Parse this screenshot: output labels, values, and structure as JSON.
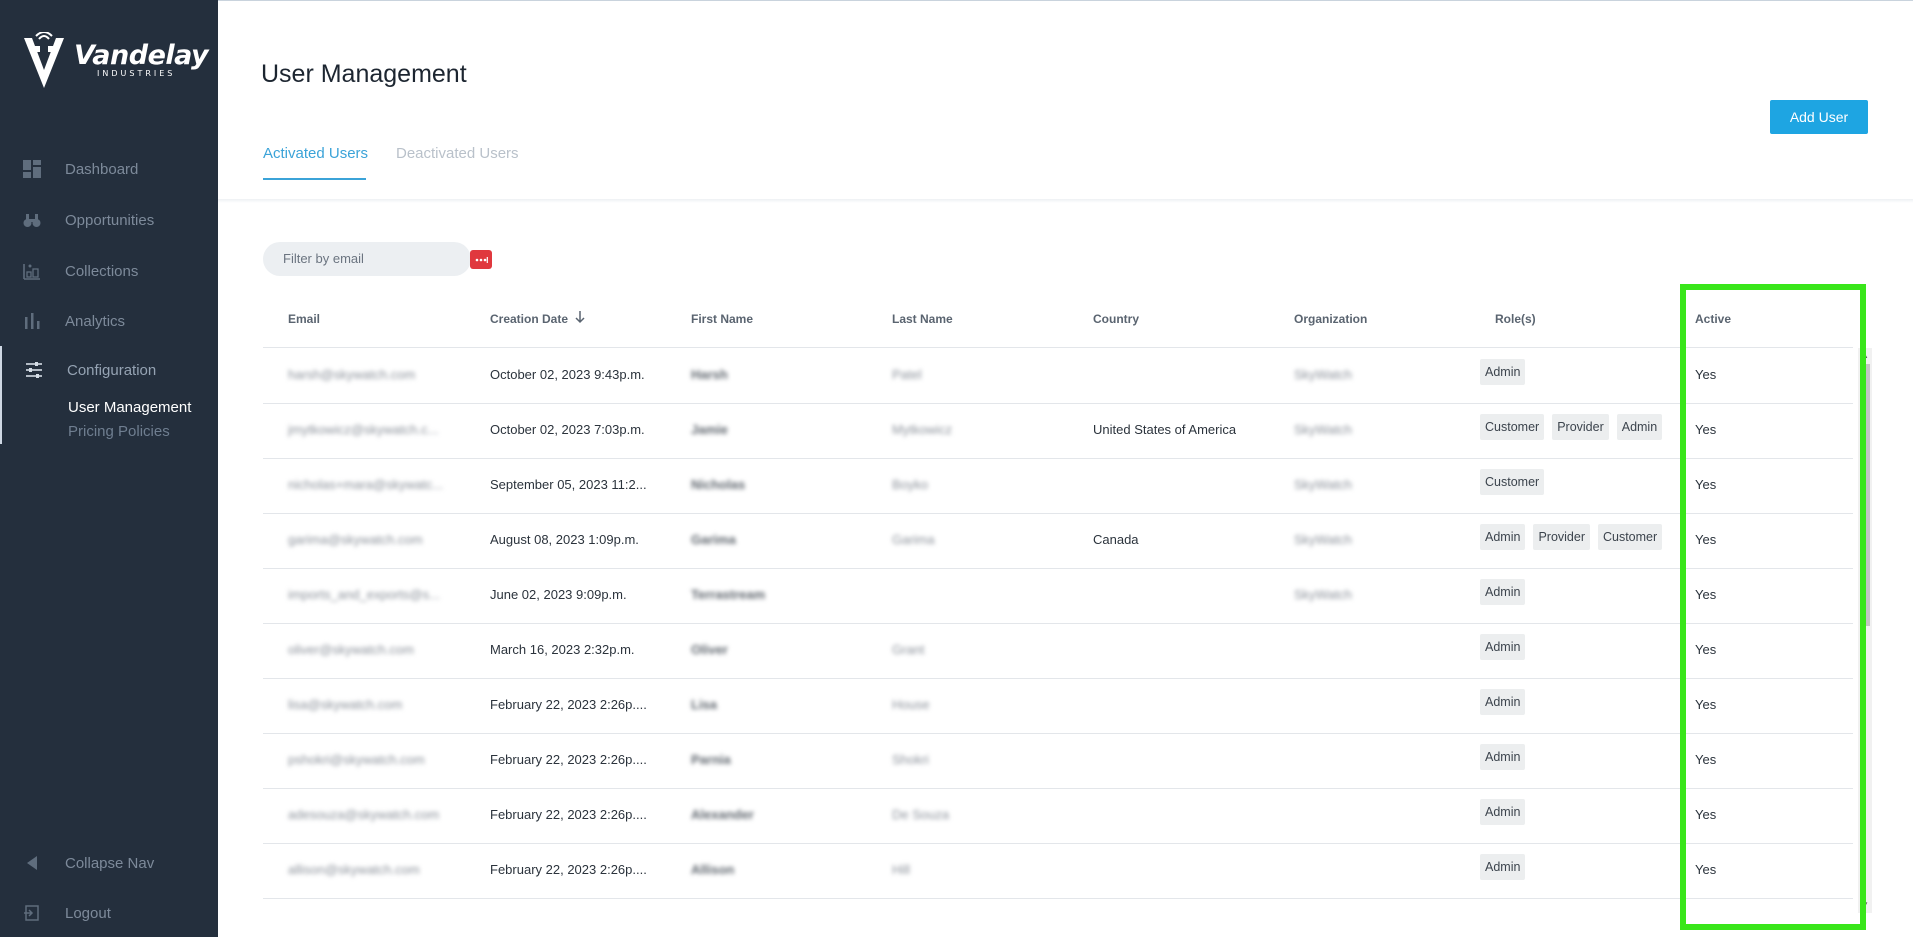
{
  "brand": {
    "name": "Vandelay",
    "sub": "INDUSTRIES"
  },
  "sidebar": {
    "items": [
      {
        "label": "Dashboard",
        "icon": "dashboard-icon"
      },
      {
        "label": "Opportunities",
        "icon": "binoculars-icon"
      },
      {
        "label": "Collections",
        "icon": "collections-icon"
      },
      {
        "label": "Analytics",
        "icon": "bar-chart-icon"
      },
      {
        "label": "Configuration",
        "icon": "sliders-icon"
      }
    ],
    "subitems": [
      {
        "label": "User Management",
        "active": true
      },
      {
        "label": "Pricing Policies",
        "active": false
      }
    ],
    "collapse": "Collapse Nav",
    "logout": "Logout"
  },
  "page": {
    "title": "User Management",
    "tabs": [
      {
        "label": "Activated Users",
        "active": true
      },
      {
        "label": "Deactivated Users",
        "active": false
      }
    ],
    "add_user": "Add User",
    "filter_placeholder": "Filter by email"
  },
  "table": {
    "headers": [
      "Email",
      "Creation Date",
      "First Name",
      "Last Name",
      "Country",
      "Organization",
      "Role(s)",
      "Active"
    ],
    "rows": [
      {
        "email": "harsh@skywatch.com",
        "date": "October 02, 2023 9:43p.m.",
        "first": "Harsh",
        "last": "Patel",
        "country": "",
        "org": "SkyWatch",
        "roles": [
          "Admin"
        ],
        "active": "Yes"
      },
      {
        "email": "jmytkowicz@skywatch.c...",
        "date": "October 02, 2023 7:03p.m.",
        "first": "Jamie",
        "last": "Mytkowicz",
        "country": "United States of America",
        "org": "SkyWatch",
        "roles": [
          "Customer",
          "Provider",
          "Admin"
        ],
        "active": "Yes"
      },
      {
        "email": "nicholas+mara@skywatc...",
        "date": "September 05, 2023 11:2...",
        "first": "Nicholas",
        "last": "Boyko",
        "country": "",
        "org": "SkyWatch",
        "roles": [
          "Customer"
        ],
        "active": "Yes"
      },
      {
        "email": "garima@skywatch.com",
        "date": "August 08, 2023 1:09p.m.",
        "first": "Garima",
        "last": "Garima",
        "country": "Canada",
        "org": "SkyWatch",
        "roles": [
          "Admin",
          "Provider",
          "Customer"
        ],
        "active": "Yes"
      },
      {
        "email": "imports_and_exports@s...",
        "date": "June 02, 2023 9:09p.m.",
        "first": "Terrastream",
        "last": "",
        "country": "",
        "org": "SkyWatch",
        "roles": [
          "Admin"
        ],
        "active": "Yes"
      },
      {
        "email": "oliver@skywatch.com",
        "date": "March 16, 2023 2:32p.m.",
        "first": "Oliver",
        "last": "Grant",
        "country": "",
        "org": "",
        "roles": [
          "Admin"
        ],
        "active": "Yes"
      },
      {
        "email": "lisa@skywatch.com",
        "date": "February 22, 2023 2:26p....",
        "first": "Lisa",
        "last": "House",
        "country": "",
        "org": "",
        "roles": [
          "Admin"
        ],
        "active": "Yes"
      },
      {
        "email": "pshokri@skywatch.com",
        "date": "February 22, 2023 2:26p....",
        "first": "Parnia",
        "last": "Shokri",
        "country": "",
        "org": "",
        "roles": [
          "Admin"
        ],
        "active": "Yes"
      },
      {
        "email": "adesouza@skywatch.com",
        "date": "February 22, 2023 2:26p....",
        "first": "Alexander",
        "last": "De Souza",
        "country": "",
        "org": "",
        "roles": [
          "Admin"
        ],
        "active": "Yes"
      },
      {
        "email": "allison@skywatch.com",
        "date": "February 22, 2023 2:26p....",
        "first": "Allison",
        "last": "Hill",
        "country": "",
        "org": "",
        "roles": [
          "Admin"
        ],
        "active": "Yes"
      }
    ]
  },
  "colors": {
    "sidebar": "#242f3d",
    "accent": "#3ba3d8",
    "button": "#1ea5e2",
    "highlight": "#39e61a",
    "filter_icon": "#e0383e"
  }
}
